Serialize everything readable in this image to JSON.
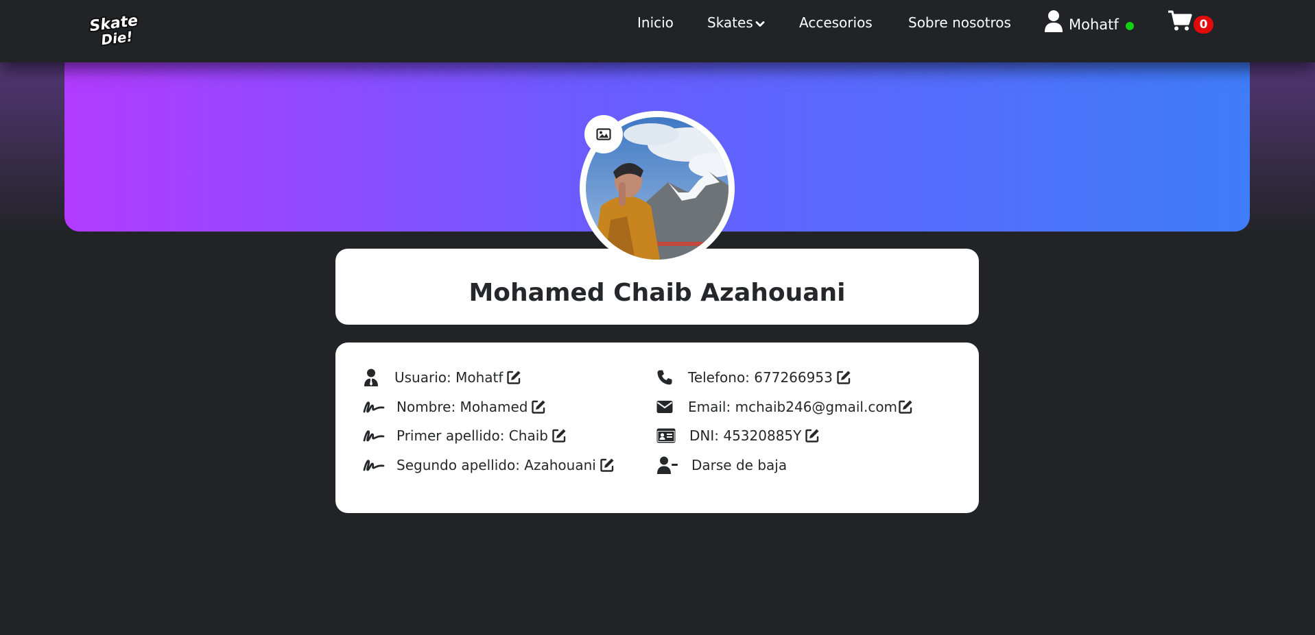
{
  "brand": {
    "logo_text_top": "Skate",
    "logo_text_bottom": "Die!"
  },
  "nav": {
    "items": [
      {
        "label": "Inicio"
      },
      {
        "label": "Skates"
      },
      {
        "label": "Accesorios"
      },
      {
        "label": "Sobre nosotros"
      }
    ],
    "user": {
      "name": "Mohatf",
      "status": "online",
      "status_color": "#12d012"
    },
    "cart": {
      "count": "0",
      "badge_color": "#e10b0b"
    }
  },
  "banner": {
    "gradient_colors": [
      "#b23bff",
      "#6a5cff",
      "#3f7dfa"
    ]
  },
  "profile": {
    "full_name": "Mohamed Chaib Azahouani",
    "fields_left": [
      {
        "icon": "user-tie-icon",
        "text": "Usuario: Mohatf"
      },
      {
        "icon": "signature-icon",
        "text": "Nombre: Mohamed"
      },
      {
        "icon": "signature-icon",
        "text": "Primer apellido: Chaib"
      },
      {
        "icon": "signature-icon",
        "text": "Segundo apellido: Azahouani"
      }
    ],
    "fields_right": [
      {
        "icon": "phone-icon",
        "text": "Telefono: 677266953"
      },
      {
        "icon": "envelope-icon",
        "text": "Email: mchaib246@gmail.com"
      },
      {
        "icon": "id-card-icon",
        "text": "DNI: 45320885Y"
      },
      {
        "icon": "user-minus-icon",
        "text": "Darse de baja"
      }
    ]
  },
  "colors": {
    "background": "#222327",
    "card": "#ffffff",
    "text": "#26272b"
  }
}
